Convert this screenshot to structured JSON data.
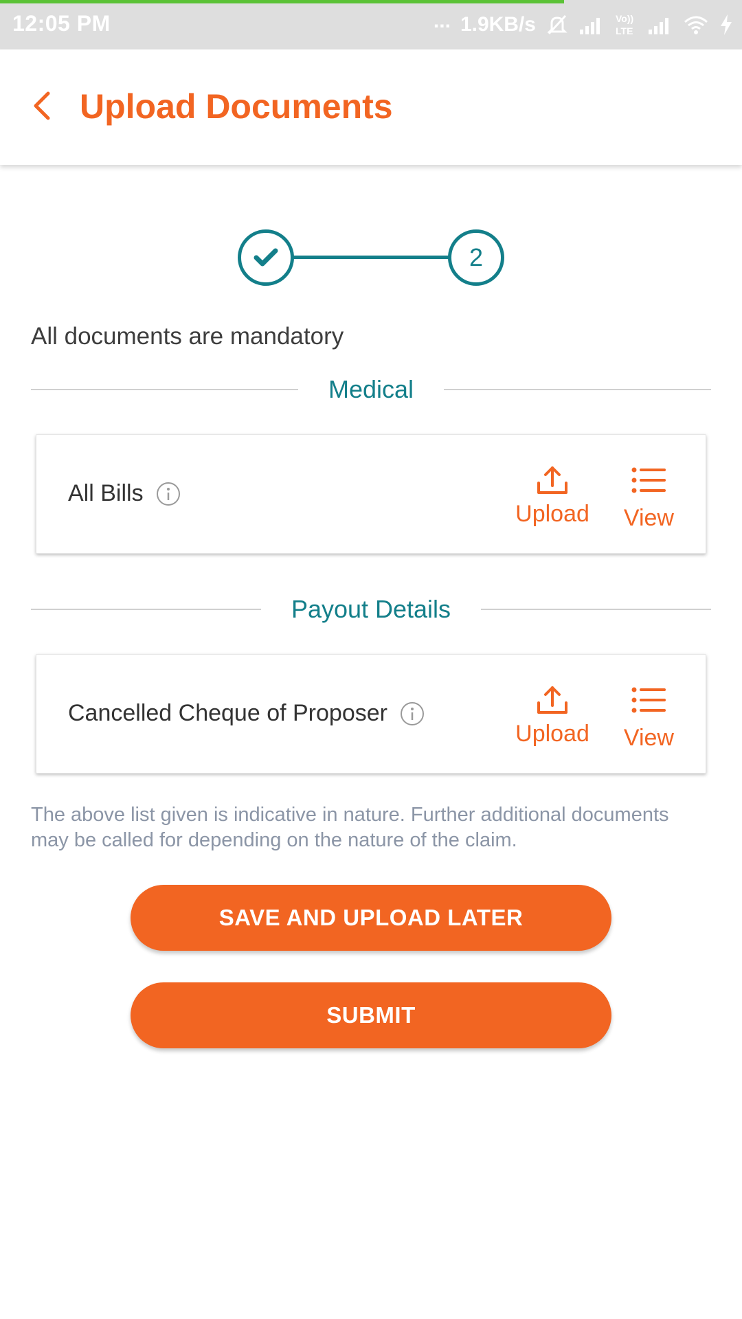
{
  "status_bar": {
    "time": "12:05 PM",
    "dots": "...",
    "net_speed": "1.9KB/s",
    "volte": "Vo)) LTE",
    "progress_fraction": 0.76
  },
  "header": {
    "title": "Upload Documents",
    "back_icon": "chevron-left-icon"
  },
  "stepper": {
    "steps": [
      {
        "state": "completed",
        "icon": "checkmark-icon"
      },
      {
        "state": "current",
        "label": "2"
      }
    ]
  },
  "note": "All documents are mandatory",
  "sections": [
    {
      "title": "Medical",
      "documents": [
        {
          "name": "All Bills",
          "upload_label": "Upload",
          "view_label": "View"
        }
      ]
    },
    {
      "title": "Payout Details",
      "documents": [
        {
          "name": "Cancelled Cheque of Proposer",
          "upload_label": "Upload",
          "view_label": "View"
        }
      ]
    }
  ],
  "disclaimer": "The above list given is indicative in nature. Further additional documents may be called for depending on the nature of the claim.",
  "buttons": {
    "save_later": "SAVE AND UPLOAD LATER",
    "submit": "SUBMIT"
  },
  "colors": {
    "accent": "#f26522",
    "teal": "#137f8a",
    "status_bar": "#dedede",
    "progress": "#5bc236"
  }
}
